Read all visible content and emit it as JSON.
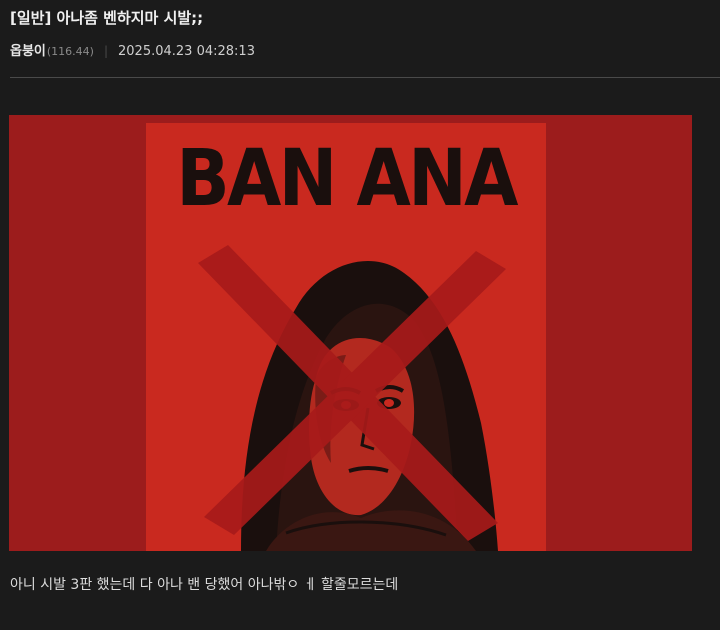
{
  "post": {
    "title": "[일반] 아나좀 벤하지마 시발;;",
    "author": "옵붕이",
    "ip": "(116.44)",
    "separator": "|",
    "datetime": "2025.04.23 04:28:13",
    "body": "아니 시발 3판 했는데 다 아나 밴 당했어 아나밖ㅇ ㅔ 할줄모르는데"
  },
  "image": {
    "headline": "BAN ANA",
    "colors": {
      "outer_background": "#9c1c1c",
      "poster_background": "#c9291f",
      "ink": "#1a0f0d",
      "cross": "#a81a1a"
    }
  }
}
